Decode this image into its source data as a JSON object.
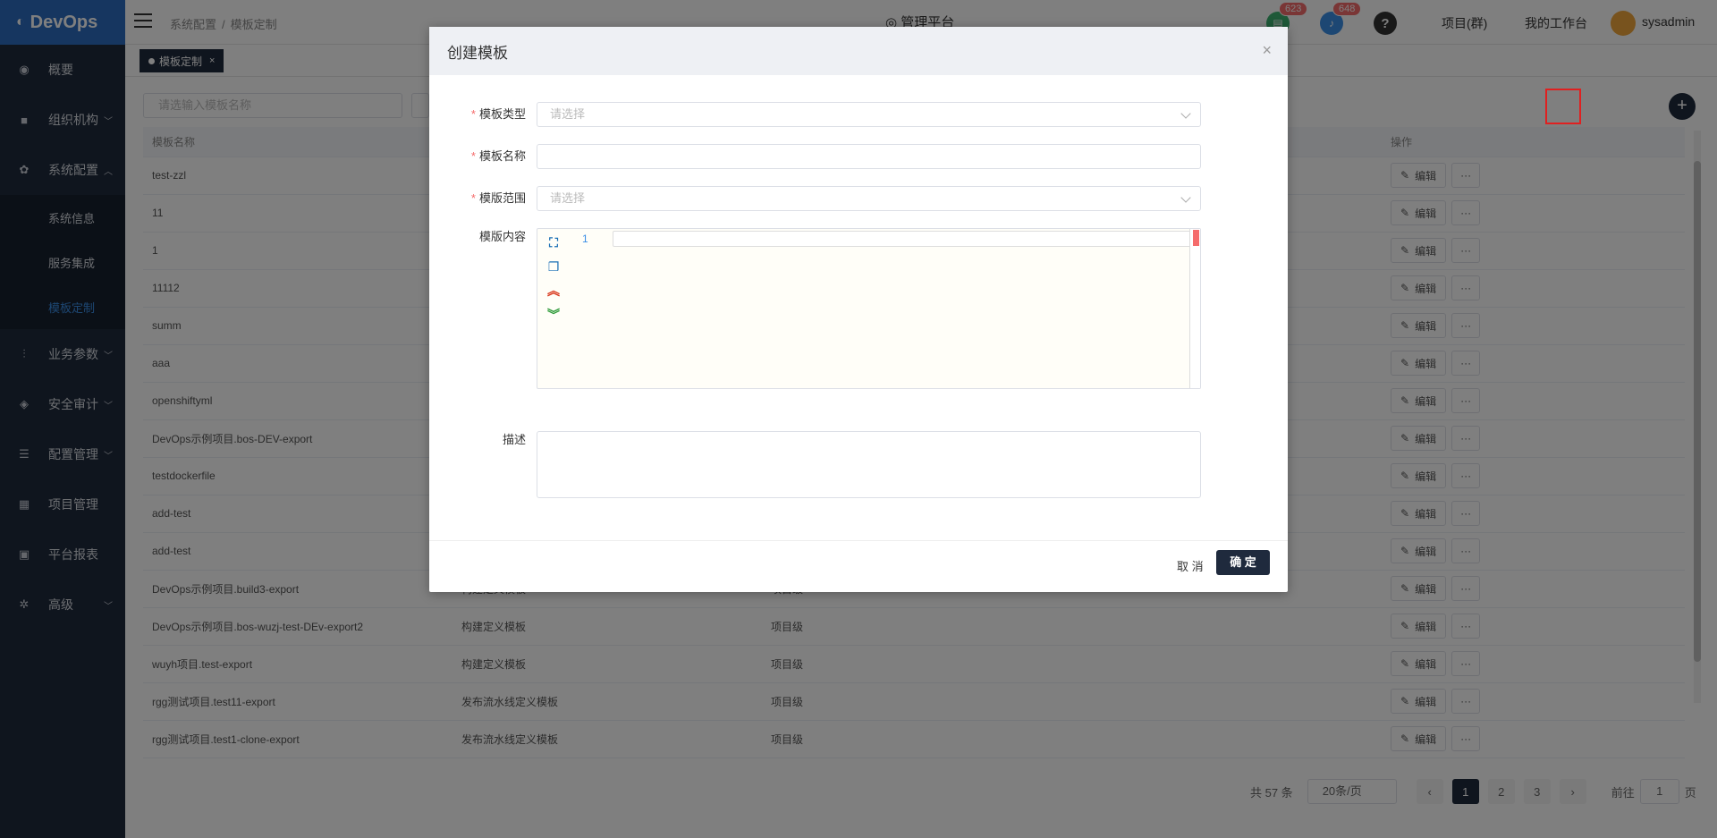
{
  "app": {
    "logo": "DevOps"
  },
  "sidebar": {
    "items": [
      {
        "label": "概要"
      },
      {
        "label": "组织机构"
      },
      {
        "label": "系统配置"
      },
      {
        "label": "业务参数"
      },
      {
        "label": "安全审计"
      },
      {
        "label": "配置管理"
      },
      {
        "label": "项目管理"
      },
      {
        "label": "平台报表"
      },
      {
        "label": "高级"
      }
    ],
    "sub_items": [
      {
        "label": "系统信息"
      },
      {
        "label": "服务集成"
      },
      {
        "label": "模板定制"
      }
    ]
  },
  "header": {
    "breadcrumb": [
      "系统配置",
      "模板定制"
    ],
    "breadcrumb_sep": "/",
    "platform_title": "管理平台",
    "badge_1": "623",
    "badge_2": "648",
    "help_icon": "?",
    "link_projects": "项目(群)",
    "link_workbench": "我的工作台",
    "username": "sysadmin"
  },
  "tabs": [
    {
      "label": "模板定制",
      "close": "×"
    }
  ],
  "search": {
    "placeholder": "请选输入模板名称"
  },
  "table": {
    "headers": [
      "模板名称",
      "",
      "",
      "",
      "操作"
    ],
    "rows": [
      {
        "name": "test-zzl",
        "type": "",
        "scope": ""
      },
      {
        "name": "11",
        "type": "",
        "scope": ""
      },
      {
        "name": "1",
        "type": "",
        "scope": ""
      },
      {
        "name": "11112",
        "type": "",
        "scope": ""
      },
      {
        "name": "summ",
        "type": "",
        "scope": ""
      },
      {
        "name": "aaa",
        "type": "",
        "scope": ""
      },
      {
        "name": "openshiftyml",
        "type": "",
        "scope": ""
      },
      {
        "name": "DevOps示例项目.bos-DEV-export",
        "type": "",
        "scope": ""
      },
      {
        "name": "testdockerfile",
        "type": "",
        "scope": ""
      },
      {
        "name": "add-test",
        "type": "",
        "scope": ""
      },
      {
        "name": "add-test",
        "type": "",
        "scope": ""
      },
      {
        "name": "DevOps示例项目.build3-export",
        "type": "构建定义模板",
        "scope": "项目级"
      },
      {
        "name": "DevOps示例项目.bos-wuzj-test-DEv-export2",
        "type": "构建定义模板",
        "scope": "项目级"
      },
      {
        "name": "wuyh项目.test-export",
        "type": "构建定义模板",
        "scope": "项目级"
      },
      {
        "name": "rgg测试项目.test11-export",
        "type": "发布流水线定义模板",
        "scope": "项目级"
      },
      {
        "name": "rgg测试项目.test1-clone-export",
        "type": "发布流水线定义模板",
        "scope": "项目级"
      }
    ],
    "edit_label": "编辑",
    "more_label": "···"
  },
  "pager": {
    "total": "共 57 条",
    "page_size": "20条/页",
    "pages": [
      "1",
      "2",
      "3"
    ],
    "prev": "‹",
    "next": "›",
    "goto_label": "前往",
    "goto_value": "1",
    "goto_suffix": "页"
  },
  "modal": {
    "title": "创建模板",
    "close": "×",
    "fields": {
      "type_label": "模板类型",
      "type_placeholder": "请选择",
      "name_label": "模板名称",
      "scope_label": "模版范围",
      "scope_placeholder": "请选择",
      "content_label": "模版内容",
      "desc_label": "描述"
    },
    "required_mark": "*",
    "editor_line": "1",
    "cancel": "取 消",
    "ok": "确 定"
  },
  "colors": {
    "sidebar_bg": "#1f2a3d",
    "logo_bg": "#2d6cc0",
    "active": "#3a8ee6",
    "badge": "#f56c6c"
  }
}
